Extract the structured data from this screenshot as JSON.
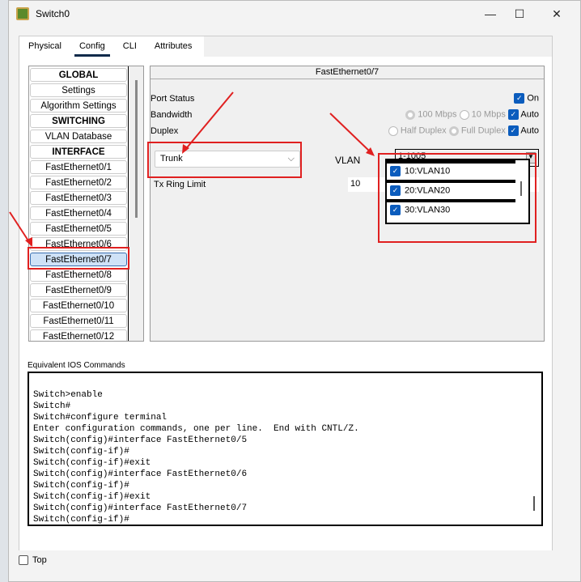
{
  "window": {
    "title": "Switch0",
    "minimize": "—",
    "maximize": "☐",
    "close": "✕"
  },
  "tabs": [
    {
      "label": "Physical"
    },
    {
      "label": "Config",
      "active": true
    },
    {
      "label": "CLI"
    },
    {
      "label": "Attributes"
    }
  ],
  "sidebar": {
    "items": [
      "GLOBAL",
      "Settings",
      "Algorithm Settings",
      "SWITCHING",
      "VLAN Database",
      "INTERFACE",
      "FastEthernet0/1",
      "FastEthernet0/2",
      "FastEthernet0/3",
      "FastEthernet0/4",
      "FastEthernet0/5",
      "FastEthernet0/6",
      "FastEthernet0/7",
      "FastEthernet0/8",
      "FastEthernet0/9",
      "FastEthernet0/10",
      "FastEthernet0/11",
      "FastEthernet0/12"
    ],
    "selected": "FastEthernet0/7"
  },
  "interface": {
    "title": "FastEthernet0/7",
    "port_status_label": "Port Status",
    "port_status_on": "On",
    "bandwidth_label": "Bandwidth",
    "bw_100": "100 Mbps",
    "bw_10": "10 Mbps",
    "bw_auto": "Auto",
    "duplex_label": "Duplex",
    "half": "Half Duplex",
    "full": "Full Duplex",
    "duplex_auto": "Auto",
    "mode": "Trunk",
    "vlan_label": "VLAN",
    "vlan_value": "1-1005",
    "vlan_options": [
      {
        "label": "10:VLAN10",
        "checked": true
      },
      {
        "label": "20:VLAN20",
        "checked": true
      },
      {
        "label": "30:VLAN30",
        "checked": true
      }
    ],
    "tx_label": "Tx Ring Limit",
    "tx_value": "10"
  },
  "ios": {
    "label": "Equivalent IOS Commands",
    "text": "Switch>enable\nSwitch#\nSwitch#configure terminal\nEnter configuration commands, one per line.  End with CNTL/Z.\nSwitch(config)#interface FastEthernet0/5\nSwitch(config-if)#\nSwitch(config-if)#exit\nSwitch(config)#interface FastEthernet0/6\nSwitch(config-if)#\nSwitch(config-if)#exit\nSwitch(config)#interface FastEthernet0/7\nSwitch(config-if)#"
  },
  "footer": {
    "top_label": "Top"
  },
  "colors": {
    "accent": "#0b5cbd",
    "annotation": "#e02020"
  }
}
